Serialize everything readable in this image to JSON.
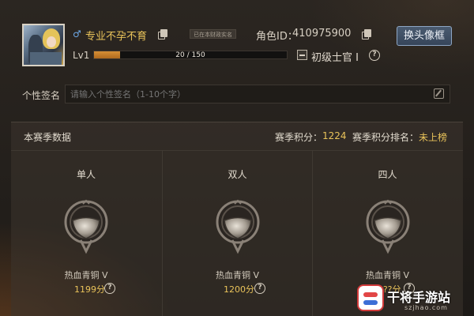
{
  "profile": {
    "gender_symbol": "♂",
    "nickname": "专业不孕不育",
    "tag": "已在本财政实名",
    "role_id_label": "角色ID：",
    "role_id_value": "410975900",
    "change_frame_label": "换头像框",
    "level_label": "Lv1",
    "xp_text": "20 / 150",
    "xp_progress": 0.1333,
    "rank_title": "初级士官 I",
    "help_glyph": "?"
  },
  "signature": {
    "label": "个性签名",
    "placeholder": "请输入个性签名（1-10个字）"
  },
  "season": {
    "title": "本赛季数据",
    "score_label": "赛季积分：",
    "score_value": "1224",
    "rank_label": "赛季积分排名：",
    "rank_value": "未上榜",
    "modes": [
      {
        "name": "单人",
        "tier": "热血青铜 V",
        "score": "1199分"
      },
      {
        "name": "双人",
        "tier": "热血青铜 V",
        "score": "1200分"
      },
      {
        "name": "四人",
        "tier": "热血青铜 V",
        "score": "1???分"
      }
    ]
  },
  "watermark": {
    "text": "干将手游站",
    "sub": "szjhao.com"
  },
  "colors": {
    "accent_gold": "#e9c35a",
    "xp_fill": "#d68f35",
    "button_blue": "#4a5b70"
  }
}
